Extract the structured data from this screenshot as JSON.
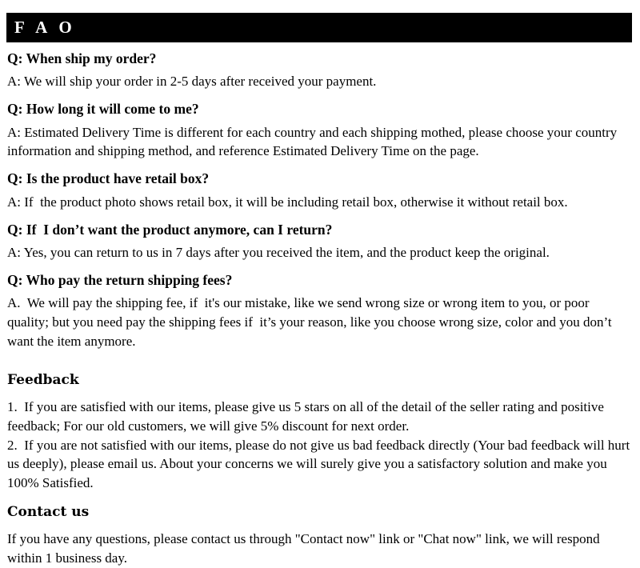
{
  "banner": {
    "title": "F A O"
  },
  "faq": {
    "items": [
      {
        "question": "Q: When ship my order?",
        "answer": "A: We will ship your order in 2-5 days after received your payment."
      },
      {
        "question": "Q: How long it will come to me?",
        "answer": "A: Estimated Delivery Time is different for each country and each shipping mothed, please choose your country information and shipping method, and reference Estimated Delivery Time on the page."
      },
      {
        "question": "Q: Is the product have retail box?",
        "answer": "A: If  the product photo shows retail box, it will be including retail box, otherwise it without retail box."
      },
      {
        "question": "Q: If  I don’t want the product anymore, can I return?",
        "answer": "A: Yes, you can return to us in 7 days after you received the item, and the product keep the original."
      },
      {
        "question": "Q: Who pay the return shipping fees?",
        "answer": "A.  We will pay the shipping fee, if  it's our mistake, like we send wrong size or wrong item to you, or poor quality; but you need pay the shipping fees if  it’s your reason, like you choose wrong size, color and you don’t want the item anymore."
      }
    ]
  },
  "feedback": {
    "heading": "Feedback",
    "paragraphs": [
      "1.  If you are satisfied with our items, please give us 5 stars on all of the detail of the seller rating and positive feedback; For our old customers, we will give 5% discount for next order.",
      "2.  If you are not satisfied with our items, please do not give us bad feedback directly (Your bad feedback will hurt us deeply), please email us. About your concerns we will surely give you a satisfactory solution and make you 100% Satisfied."
    ]
  },
  "contact": {
    "heading": "Contact us",
    "paragraphs": [
      "If you have any questions, please contact us through \"Contact now\" link or \"Chat now\" link, we will respond within 1 business day."
    ]
  },
  "colors": {
    "banner_background": "#000000",
    "banner_text": "#ffffff",
    "page_background": "#ffffff",
    "body_text": "#000000"
  }
}
